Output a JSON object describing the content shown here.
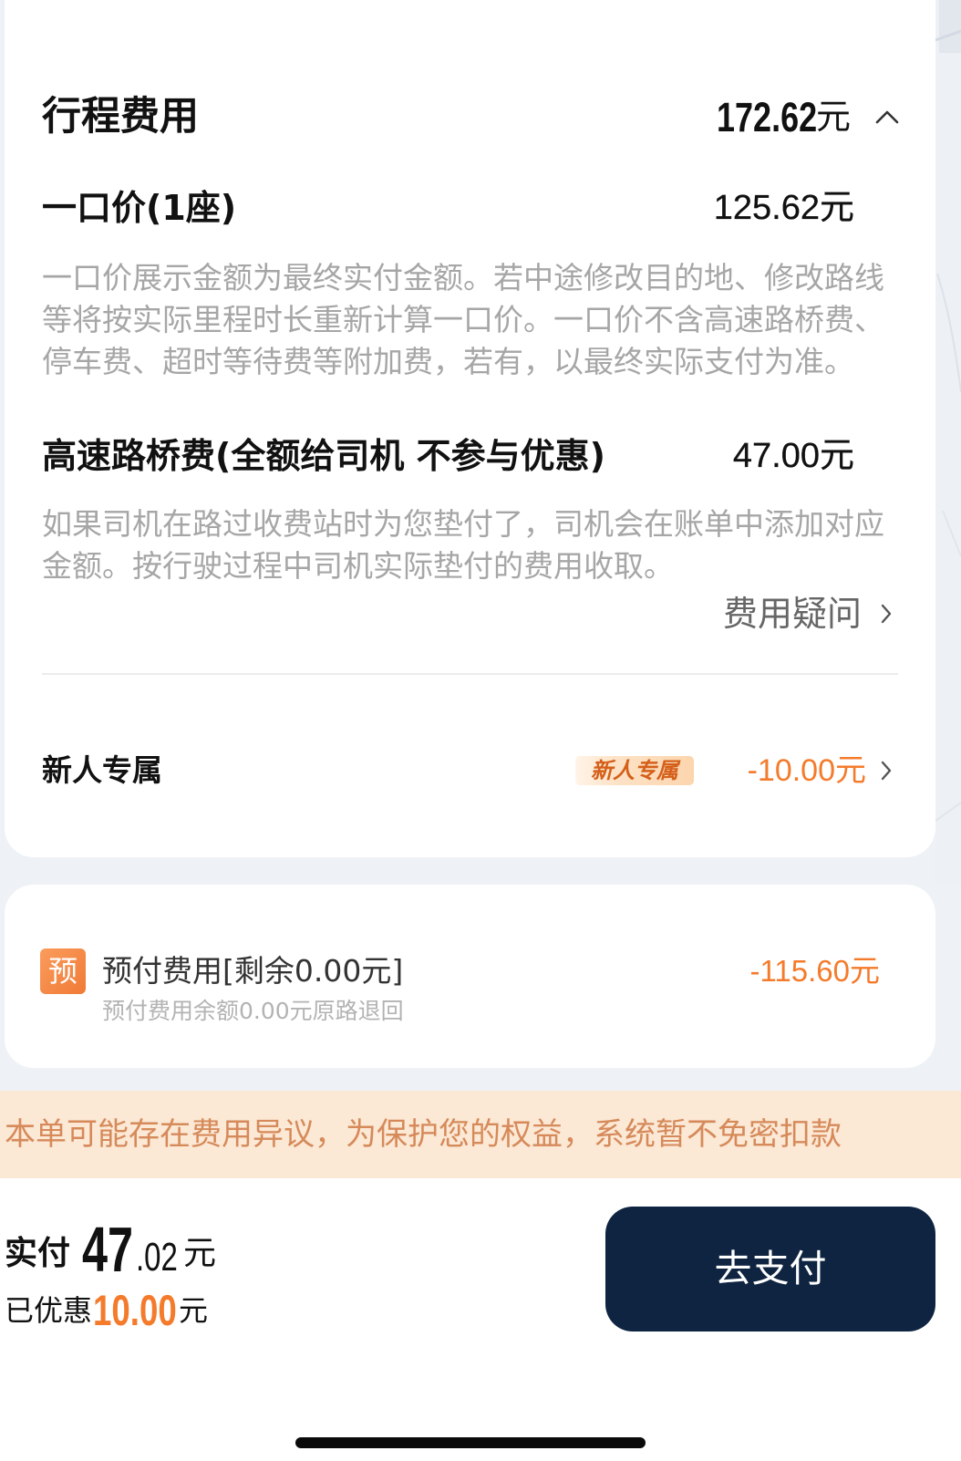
{
  "trip_fee": {
    "title": "行程费用",
    "total_amount": "172.62",
    "total_unit": "元",
    "toggle_icon": "chevron-up-icon"
  },
  "fixed_price": {
    "label": "一口价(1座)",
    "amount": "125.62元",
    "description_lines": [
      "一口价展示金额为最终实付金额。若中途修改目的地、修改路线",
      "等将按实际里程时长重新计算一口价。一口价不含高速路桥费、",
      "停车费、超时等待费等附加费，若有，以最终实际支付为准。"
    ]
  },
  "toll": {
    "label": "高速路桥费(全额给司机 不参与优惠)",
    "amount": "47.00元",
    "description_lines": [
      "如果司机在路过收费站时为您垫付了，司机会在账单中添加对应",
      "金额。按行驶过程中司机实际垫付的费用收取。"
    ]
  },
  "fee_question": {
    "label": "费用疑问",
    "icon": "chevron-right-icon"
  },
  "newcomer_discount": {
    "label": "新人专属",
    "badge": "新人专属",
    "amount": "-10.00元",
    "icon": "chevron-right-icon"
  },
  "prepaid": {
    "icon_text": "预",
    "title": "预付费用[剩余0.00元]",
    "subtitle": "预付费用余额0.00元原路退回",
    "amount": "-115.60元"
  },
  "notice": {
    "text": "本单可能存在费用异议，为保护您的权益，系统暂不免密扣款"
  },
  "payment": {
    "paid_label": "实付",
    "paid_integer": "47",
    "paid_decimal": ".02",
    "paid_unit": "元",
    "discount_label": "已优惠",
    "discount_amount": "10.00",
    "discount_unit": "元",
    "pay_button_label": "去支付"
  },
  "colors": {
    "accent": "#f47b2c",
    "pay_button": "#0f2441",
    "notice_background": "#fbe8d5",
    "notice_text": "#d68a5a",
    "badge_text": "#d4601a",
    "page_background": "#eef1f5"
  }
}
